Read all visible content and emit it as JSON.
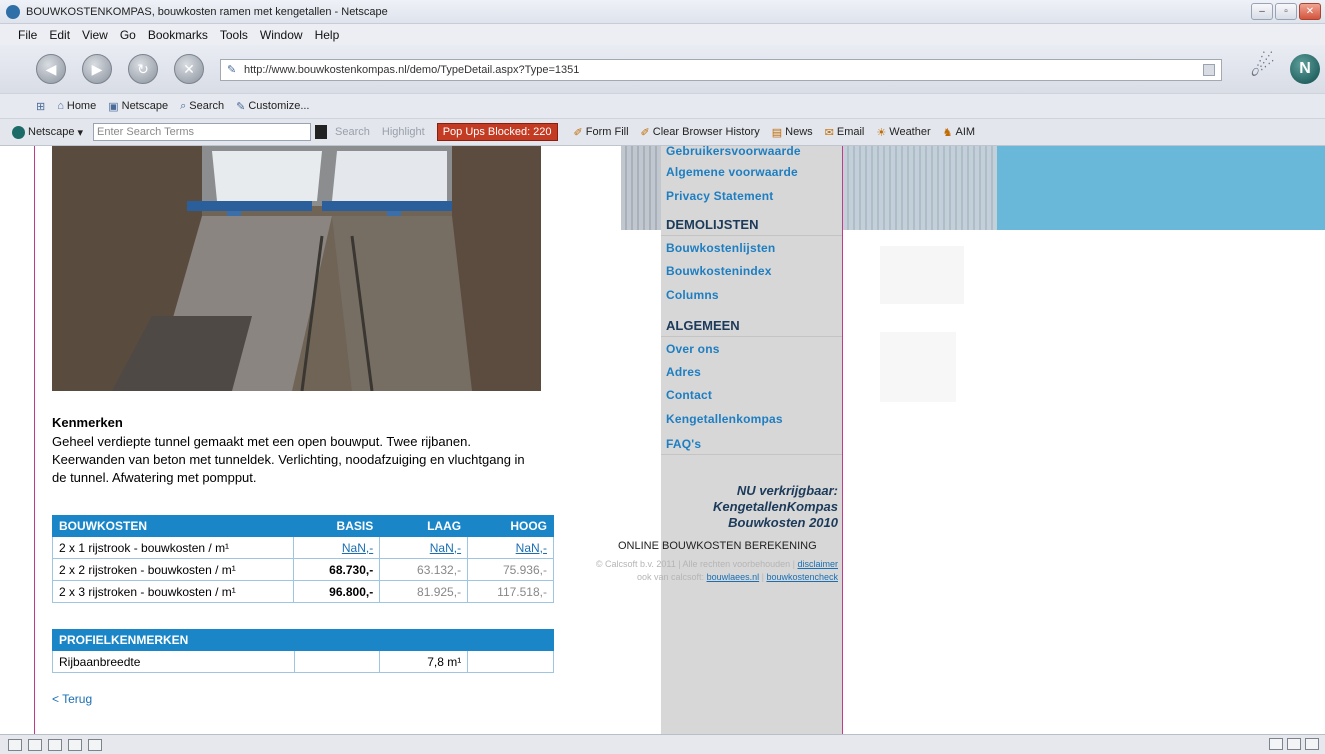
{
  "window": {
    "title": "BOUWKOSTENKOMPAS, bouwkosten ramen met kengetallen - Netscape",
    "controls": [
      "–",
      "▫",
      "✕"
    ]
  },
  "menu": [
    "File",
    "Edit",
    "View",
    "Go",
    "Bookmarks",
    "Tools",
    "Window",
    "Help"
  ],
  "nav": {
    "url": "http://www.bouwkostenkompas.nl/demo/TypeDetail.aspx?Type=1351"
  },
  "bookmarks": [
    "Home",
    "Netscape",
    "Search",
    "Customize..."
  ],
  "searchbar": {
    "brand": "Netscape",
    "placeholder": "Enter Search Terms",
    "search": "Search",
    "highlight": "Highlight",
    "popups": "Pop Ups Blocked: 220",
    "tools": [
      "Form Fill",
      "Clear Browser History",
      "News",
      "Email",
      "Weather",
      "AIM"
    ]
  },
  "content": {
    "kenmerken_title": "Kenmerken",
    "kenmerken_text": "Geheel verdiepte tunnel gemaakt met een open bouwput. Twee rijbanen. Keerwanden van beton met tunneldek. Verlichting, noodafzuiging en vluchtgang in de tunnel. Afwatering met pompput.",
    "costs": {
      "headers": [
        "BOUWKOSTEN",
        "BASIS",
        "LAAG",
        "HOOG"
      ],
      "rows": [
        [
          "2 x 1 rijstrook - bouwkosten / m¹",
          "NaN,-",
          "NaN,-",
          "NaN,-"
        ],
        [
          "2 x 2 rijstroken - bouwkosten / m¹",
          "68.730,-",
          "63.132,-",
          "75.936,-"
        ],
        [
          "2 x 3 rijstroken - bouwkosten / m¹",
          "96.800,-",
          "81.925,-",
          "117.518,-"
        ]
      ]
    },
    "profiel": {
      "header": "PROFIELKENMERKEN",
      "row": [
        "Rijbaanbreedte",
        "",
        "7,8 m¹",
        ""
      ]
    },
    "back": "< Terug"
  },
  "sidebar": {
    "top_links": [
      "Gebruikersvoorwaarde",
      "Algemene voorwaarde",
      "Privacy Statement"
    ],
    "heading1": "DEMOLIJSTEN",
    "demo_links": [
      "Bouwkostenlijsten",
      "Bouwkostenindex",
      "Columns"
    ],
    "heading2": "ALGEMEEN",
    "general_links": [
      "Over ons",
      "Adres",
      "Contact",
      "Kengetallenkompas",
      "FAQ's"
    ],
    "promo": "NU verkrijgbaar: KengetallenKompas Bouwkosten 2010"
  },
  "footer": {
    "online_calc": "ONLINE BOUWKOSTEN BEREKENING",
    "copyright": "© Calcsoft b.v. 2011 | Alle rechten voorbehouden | ",
    "disclaimer": "disclaimer",
    "also": "ook van calcsoft: ",
    "link1": "bouwlaees.nl",
    "sep": " | ",
    "link2": "bouwkostencheck"
  },
  "colors": {
    "accent": "#1a86c8",
    "divider": "#c03c8a",
    "banner": "#69b7d9",
    "sidebar": "#d7d7d7"
  }
}
